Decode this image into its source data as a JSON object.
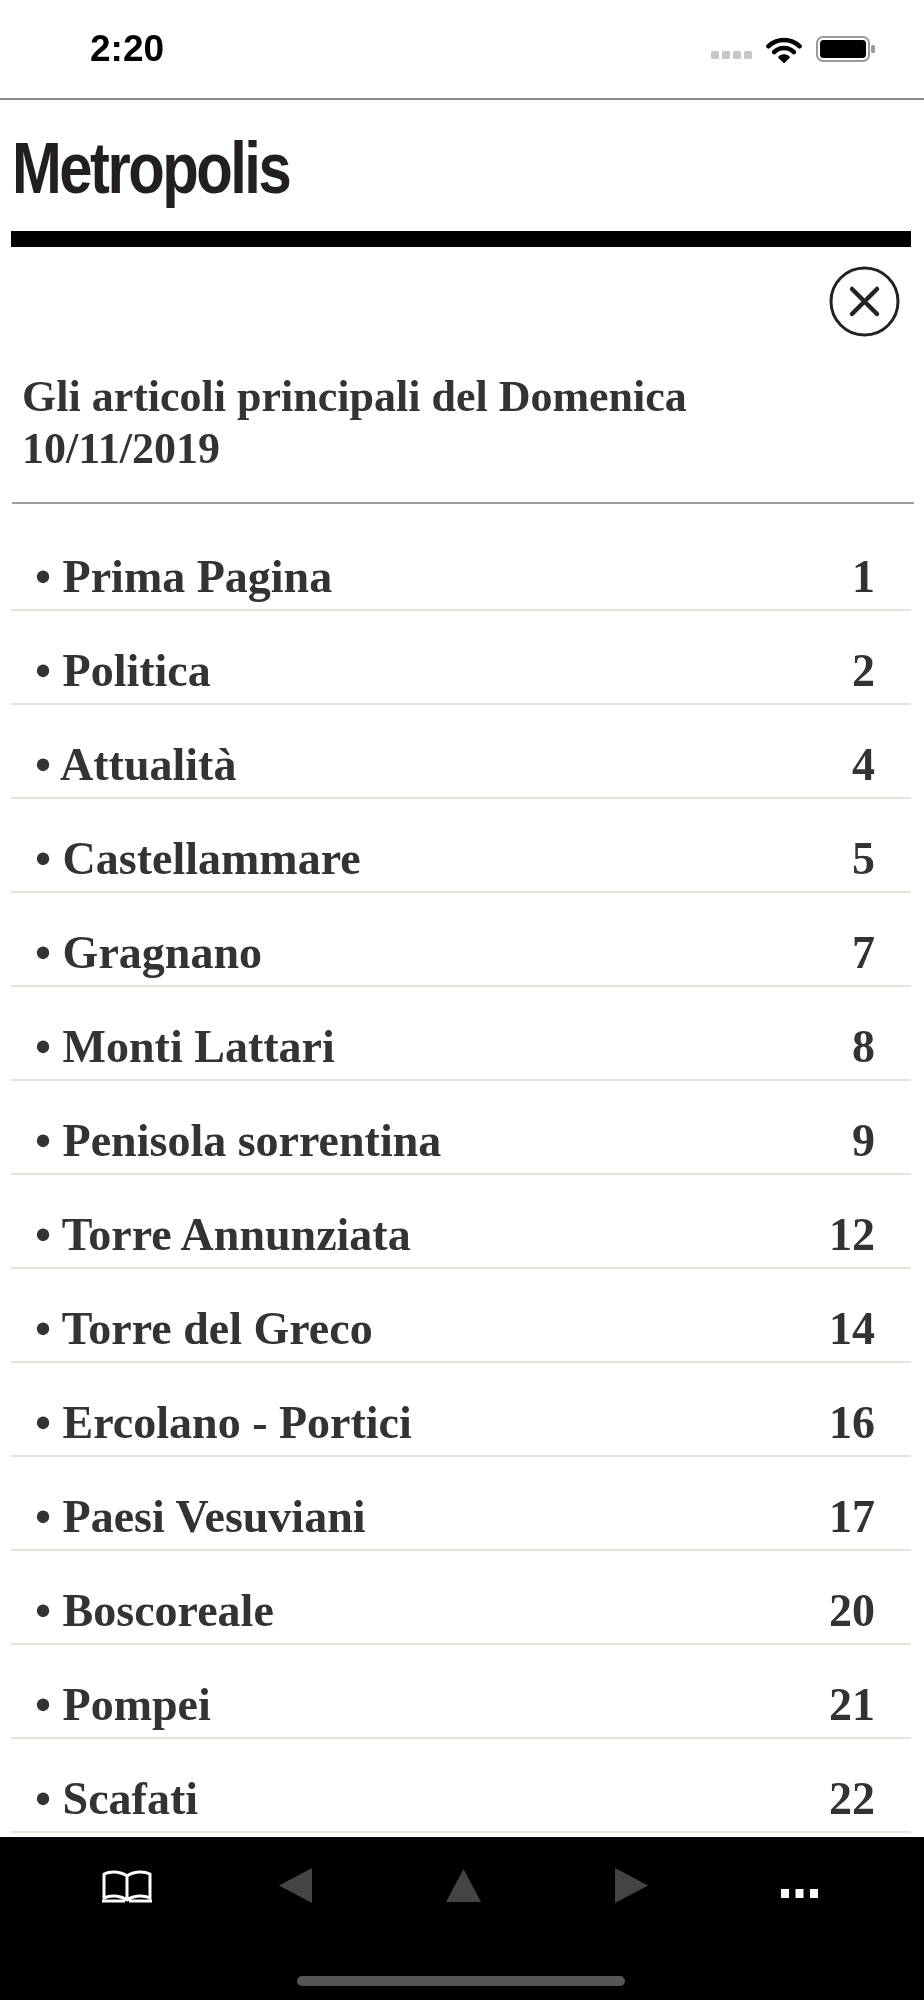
{
  "status_bar": {
    "time": "2:20"
  },
  "header": {
    "logo": "Metropolis"
  },
  "panel": {
    "title": "Gli articoli principali del Domenica 10/11/2019",
    "sections": [
      {
        "title": "• Prima Pagina",
        "page": "1"
      },
      {
        "title": "• Politica",
        "page": "2"
      },
      {
        "title": "• Attualità",
        "page": "4"
      },
      {
        "title": "• Castellammare",
        "page": "5"
      },
      {
        "title": "• Gragnano",
        "page": "7"
      },
      {
        "title": "• Monti Lattari",
        "page": "8"
      },
      {
        "title": "• Penisola sorrentina",
        "page": "9"
      },
      {
        "title": "• Torre Annunziata",
        "page": "12"
      },
      {
        "title": "• Torre del Greco",
        "page": "14"
      },
      {
        "title": "• Ercolano - Portici",
        "page": "16"
      },
      {
        "title": "• Paesi Vesuviani",
        "page": "17"
      },
      {
        "title": "• Boscoreale",
        "page": "20"
      },
      {
        "title": "• Pompei",
        "page": "21"
      },
      {
        "title": "• Scafati",
        "page": "22"
      }
    ]
  },
  "toolbar": [
    {
      "kind": "contents",
      "disabled": false
    },
    {
      "kind": "previous",
      "disabled": true
    },
    {
      "kind": "up",
      "disabled": true
    },
    {
      "kind": "next",
      "disabled": true
    },
    {
      "kind": "more",
      "disabled": false
    }
  ]
}
